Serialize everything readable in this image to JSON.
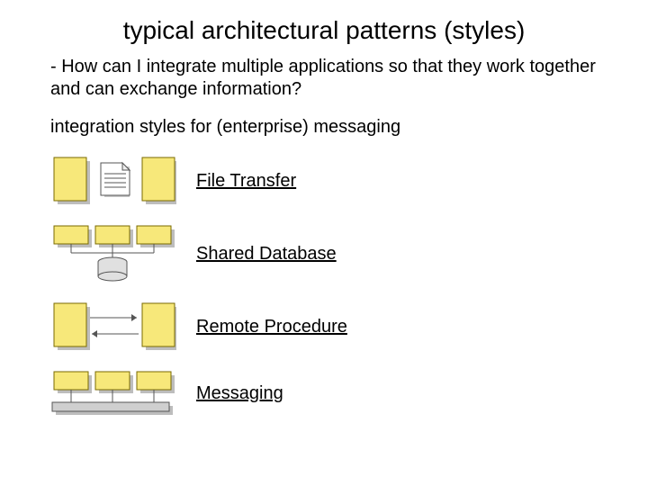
{
  "title": "typical architectural patterns (styles)",
  "question": "- How can I integrate multiple applications so that they work together and can exchange information?",
  "subhead": "integration styles for (enterprise) messaging",
  "patterns": {
    "file_transfer": "File Transfer",
    "shared_database": "Shared Database",
    "remote_procedure": "Remote Procedure",
    "messaging": "Messaging"
  },
  "colors": {
    "box_fill": "#f7e87a",
    "box_stroke": "#7a6a00",
    "shadow": "#bdbdbd",
    "db_fill": "#e0e0e0",
    "bus_fill": "#cfcfcf",
    "doc_fill": "#ffffff"
  }
}
